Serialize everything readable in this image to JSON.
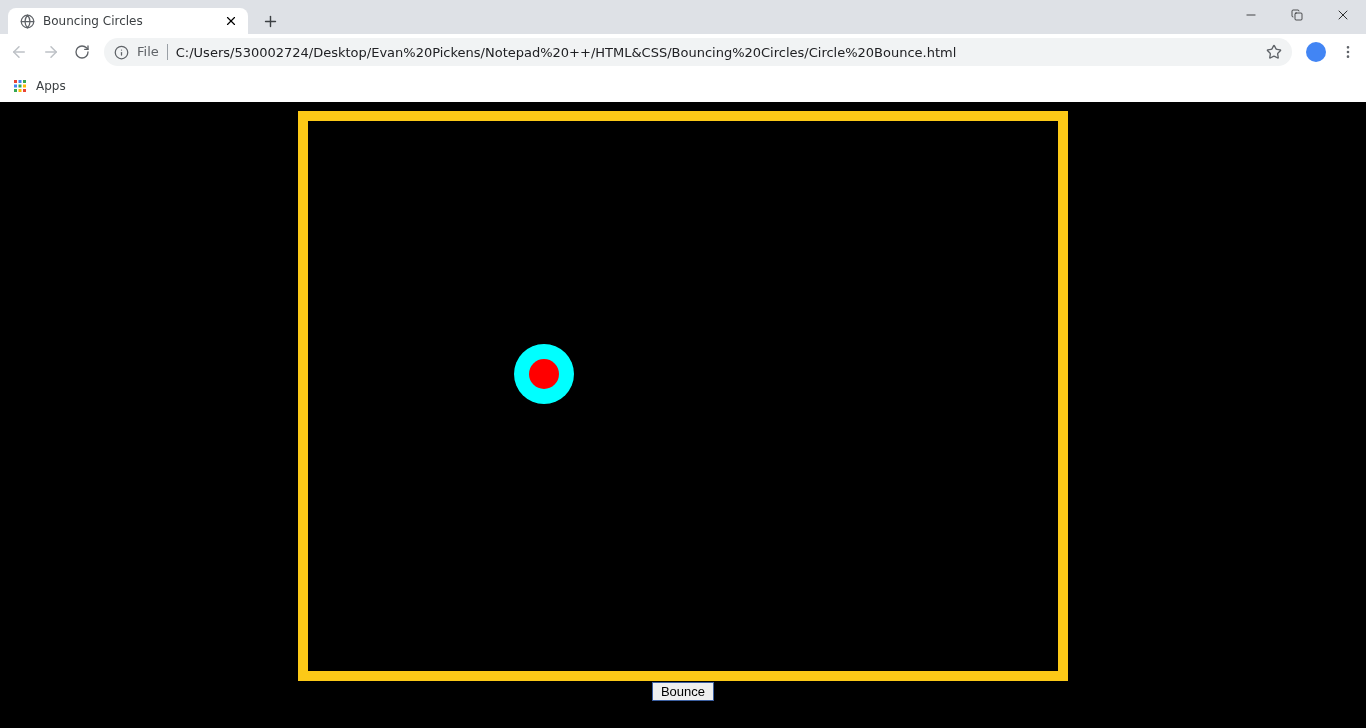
{
  "browser": {
    "tab": {
      "title": "Bouncing Circles",
      "selected": true
    },
    "address_bar": {
      "scheme_label": "File",
      "url": "C:/Users/530002724/Desktop/Evan%20Pickens/Notepad%20++/HTML&CSS/Bouncing%20Circles/Circle%20Bounce.html"
    },
    "bookmarks": [
      "Apps"
    ]
  },
  "page": {
    "button": "Bounce"
  }
}
